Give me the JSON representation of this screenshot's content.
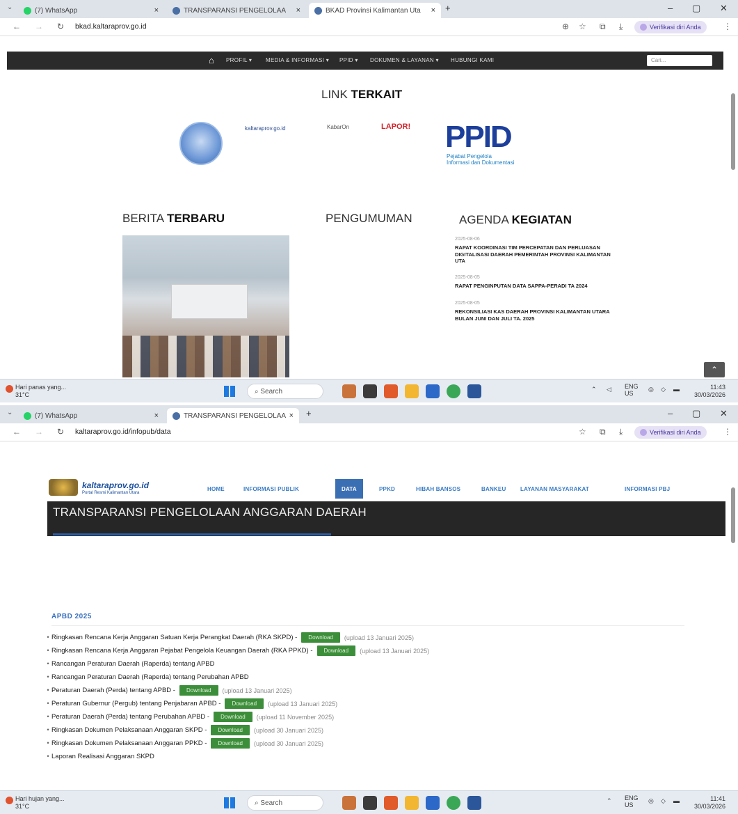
{
  "top_window": {
    "tabs": [
      {
        "label": "(7) WhatsApp"
      },
      {
        "label": "TRANSPARANSI PENGELOLAA"
      },
      {
        "label": "BKAD Provinsi Kalimantan Uta"
      }
    ],
    "new_tab": "+",
    "url": "bkad.kaltaraprov.go.id",
    "verify_label": "Verifikasi diri Anda",
    "nav": {
      "items": [
        "PROFIL ▾",
        "MEDIA & INFORMASI ▾",
        "PPID ▾",
        "DOKUMEN & LAYANAN ▾",
        "HUBUNGI KAMI"
      ],
      "search_placeholder": "Cari..."
    },
    "link_terkait": {
      "light": "LINK ",
      "bold": "TERKAIT"
    },
    "links": {
      "kaltara": "kaltaraprov.go.id",
      "kabar": "KabarOn",
      "lapor": "LAPOR!",
      "ppid": "PPID",
      "ppid_sub1": "Pejabat Pengelola",
      "ppid_sub2": "Informasi dan Dokumentasi"
    },
    "berita": {
      "light": "BERITA ",
      "bold": "TERBARU"
    },
    "pengumuman": "PENGUMUMAN",
    "agenda": {
      "light": "AGENDA ",
      "bold": "KEGIATAN"
    },
    "agenda_items": [
      {
        "date": "2025-08-06",
        "title": "RAPAT KOORDINASI TIM PERCEPATAN DAN PERLUASAN DIGITALISASI DAERAH PEMERINTAH PROVINSI KALIMANTAN UTA"
      },
      {
        "date": "2025-08-05",
        "title": "RAPAT PENGINPUTAN DATA SAPPA-PERADI TA 2024"
      },
      {
        "date": "2025-08-05",
        "title": "REKONSILIASI KAS DAERAH PROVINSI KALIMANTAN UTARA BULAN JUNI DAN JULI TA. 2025"
      }
    ],
    "taskbar": {
      "weather": "Hari panas yang...",
      "temp": "31°C",
      "search": "Search",
      "lang1": "ENG",
      "lang2": "US",
      "time": "11:43",
      "date": "30/03/2026"
    }
  },
  "bottom_window": {
    "tabs": [
      {
        "label": "(7) WhatsApp"
      },
      {
        "label": "TRANSPARANSI PENGELOLAA"
      }
    ],
    "new_tab": "+",
    "url": "kaltaraprov.go.id/infopub/data",
    "verify_label": "Verifikasi diri Anda",
    "site_name": "kaltaraprov.go.id",
    "site_sub": "Portal Resmi Kalimantan Utara",
    "menu": [
      "HOME",
      "INFORMASI PUBLIK",
      "DATA",
      "PPKD",
      "HIBAH BANSOS",
      "BANKEU",
      "LAYANAN MASYARAKAT",
      "INFORMASI PBJ"
    ],
    "banner_title": "TRANSPARANSI PENGELOLAAN ANGGARAN DAERAH",
    "apbd_title": "APBD 2025",
    "items": [
      {
        "text": "Ringkasan Rencana Kerja Anggaran Satuan Kerja Perangkat Daerah (RKA SKPD) -",
        "download": "Download",
        "upload": "(upload 13 Januari 2025)"
      },
      {
        "text": "Ringkasan Rencana Kerja Anggaran Pejabat Pengelola Keuangan Daerah (RKA PPKD) -",
        "download": "Download",
        "upload": "(upload 13 Januari 2025)"
      },
      {
        "text": "Rancangan Peraturan Daerah (Raperda) tentang APBD",
        "download": "",
        "upload": ""
      },
      {
        "text": "Rancangan Peraturan Daerah (Raperda) tentang Perubahan APBD",
        "download": "",
        "upload": ""
      },
      {
        "text": "Peraturan Daerah (Perda) tentang APBD -",
        "download": "Download",
        "upload": "(upload 13 Januari 2025)"
      },
      {
        "text": "Peraturan Gubernur (Pergub) tentang Penjabaran APBD -",
        "download": "Download",
        "upload": "(upload 13 Januari 2025)"
      },
      {
        "text": "Peraturan Daerah (Perda) tentang Perubahan APBD -",
        "download": "Download",
        "upload": "(upload 11 November 2025)"
      },
      {
        "text": "Ringkasan Dokumen Pelaksanaan Anggaran SKPD -",
        "download": "Download",
        "upload": "(upload 30 Januari 2025)"
      },
      {
        "text": "Ringkasan Dokumen Pelaksanaan Anggaran PPKD -",
        "download": "Download",
        "upload": "(upload 30 Januari 2025)"
      },
      {
        "text": "Laporan Realisasi Anggaran SKPD",
        "download": "",
        "upload": ""
      }
    ],
    "taskbar": {
      "weather": "Hari hujan yang...",
      "temp": "31°C",
      "search": "Search",
      "lang1": "ENG",
      "lang2": "US",
      "time": "11:41",
      "date": "30/03/2026"
    }
  }
}
